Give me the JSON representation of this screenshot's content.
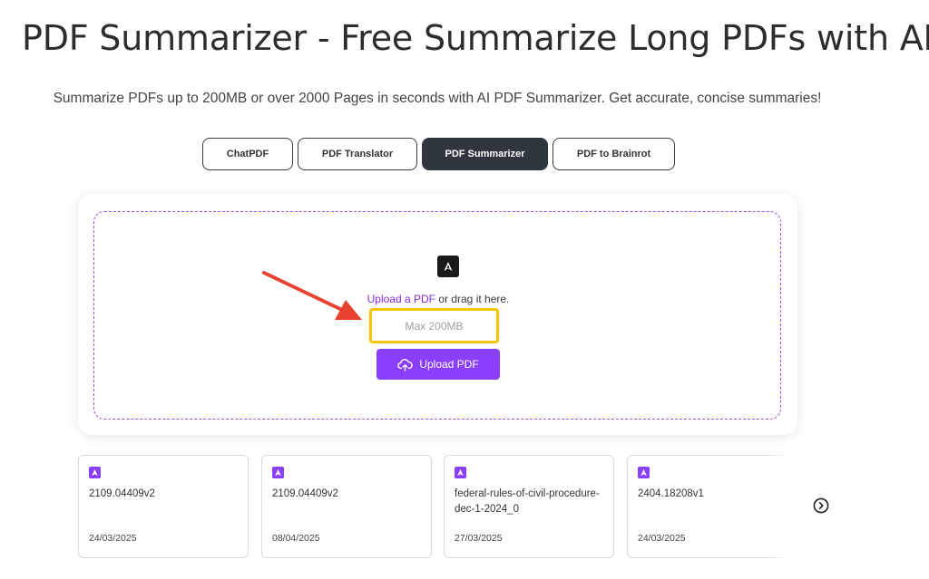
{
  "header": {
    "title": "PDF Summarizer - Free Summarize Long PDFs with AI",
    "subtitle": "Summarize PDFs up to 200MB or over 2000 Pages in seconds with AI PDF Summarizer. Get accurate, concise summaries!"
  },
  "tabs": [
    {
      "label": "ChatPDF",
      "active": false
    },
    {
      "label": "PDF Translator",
      "active": false
    },
    {
      "label": "PDF Summarizer",
      "active": true
    },
    {
      "label": "PDF to Brainrot",
      "active": false
    }
  ],
  "upload": {
    "link_text": "Upload a PDF",
    "drag_text": " or drag it here.",
    "max_size": "Max 200MB",
    "button_label": "Upload PDF",
    "icon": "pdf-file-icon",
    "button_icon": "cloud-upload-icon"
  },
  "recent_files": [
    {
      "name": "2109.04409v2",
      "date": "24/03/2025"
    },
    {
      "name": "2109.04409v2",
      "date": "08/04/2025"
    },
    {
      "name": "federal-rules-of-civil-procedure-dec-1-2024_0",
      "date": "27/03/2025"
    },
    {
      "name": "2404.18208v1",
      "date": "24/03/2025"
    }
  ],
  "colors": {
    "accent": "#8a3ffc",
    "active_tab": "#2f3640",
    "highlight_box": "#f7c600",
    "annotation_arrow": "#e8432f"
  }
}
